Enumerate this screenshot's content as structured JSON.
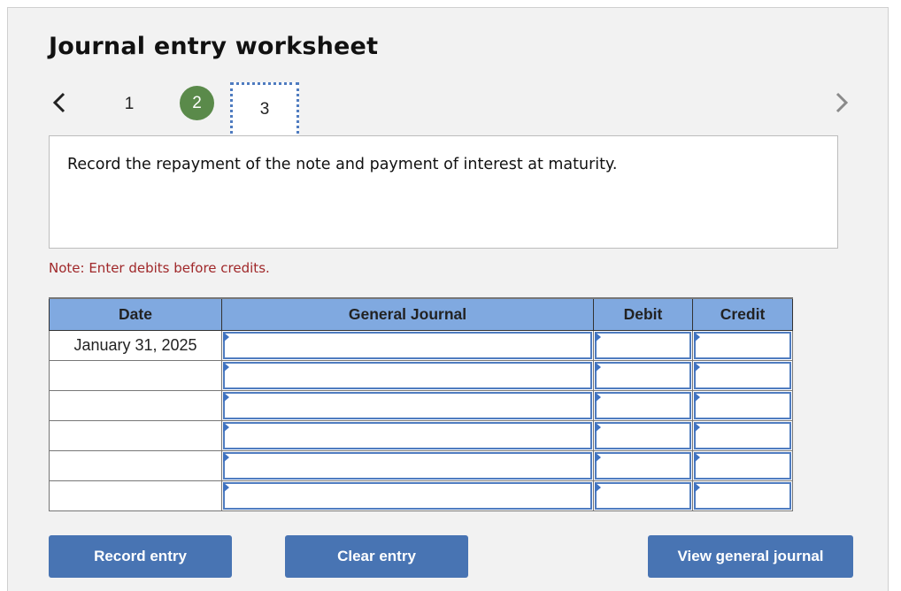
{
  "title": "Journal entry worksheet",
  "navigation": {
    "prev_icon": "chevron-left-icon",
    "next_icon": "chevron-right-icon",
    "steps": [
      {
        "label": "1",
        "state": "default"
      },
      {
        "label": "2",
        "state": "completed"
      },
      {
        "label": "3",
        "state": "current"
      }
    ],
    "completed_color": "#5a8a4a",
    "current_border_color": "#4f7cc0"
  },
  "instruction": "Record the repayment of the note and payment of interest at maturity.",
  "note": "Note: Enter debits before credits.",
  "table": {
    "headers": [
      "Date",
      "General Journal",
      "Debit",
      "Credit"
    ],
    "rows": [
      {
        "date": "January 31, 2025",
        "account": "",
        "debit": "",
        "credit": ""
      },
      {
        "date": "",
        "account": "",
        "debit": "",
        "credit": ""
      },
      {
        "date": "",
        "account": "",
        "debit": "",
        "credit": ""
      },
      {
        "date": "",
        "account": "",
        "debit": "",
        "credit": ""
      },
      {
        "date": "",
        "account": "",
        "debit": "",
        "credit": ""
      },
      {
        "date": "",
        "account": "",
        "debit": "",
        "credit": ""
      }
    ],
    "header_color": "#80a9e0"
  },
  "buttons": {
    "record": "Record entry",
    "clear": "Clear entry",
    "view": "View general journal",
    "color": "#4874b3"
  }
}
